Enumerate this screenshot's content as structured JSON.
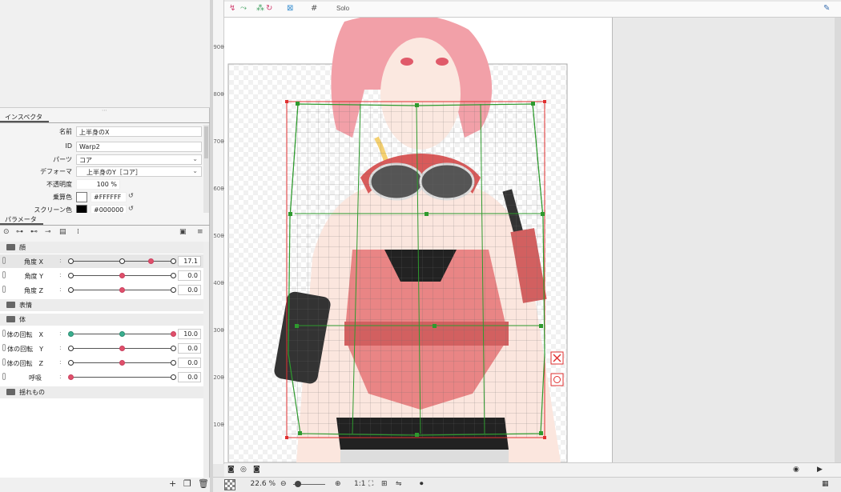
{
  "inspector": {
    "tab": "インスペクタ",
    "rows": [
      {
        "label": "名前",
        "value": "上半身のX"
      },
      {
        "label": "ID",
        "value": "Warp2"
      },
      {
        "label": "パーツ",
        "value": "コア"
      },
      {
        "label": "デフォーマ",
        "value": "上半身のY［コア］"
      },
      {
        "label": "不透明度",
        "value": "100 %"
      },
      {
        "label": "乗算色",
        "value": "#FFFFFF"
      },
      {
        "label": "スクリーン色",
        "value": "#000000"
      }
    ]
  },
  "parameters": {
    "tab": "パラメータ",
    "groups": [
      {
        "name": "顔",
        "params": [
          {
            "name": "角度 X",
            "value": "17.1",
            "pos": 0.78
          },
          {
            "name": "角度 Y",
            "value": "0.0",
            "pos": 0.5
          },
          {
            "name": "角度 Z",
            "value": "0.0",
            "pos": 0.5
          }
        ]
      },
      {
        "name": "表情",
        "params": []
      },
      {
        "name": "体",
        "params": [
          {
            "name": "体の回転　X",
            "value": "10.0",
            "pos": 1.0
          },
          {
            "name": "体の回転　Y",
            "value": "0.0",
            "pos": 0.5
          },
          {
            "name": "体の回転　Z",
            "value": "0.0",
            "pos": 0.5
          },
          {
            "name": "呼吸",
            "value": "0.0",
            "pos": 0.0
          }
        ]
      },
      {
        "name": "揺れもの",
        "params": []
      }
    ]
  },
  "viewer": {
    "solo_label": "Solo",
    "zoom": "22.6 %",
    "ratio": "1:1",
    "ruler_labels": [
      "900",
      "800",
      "700",
      "600",
      "500",
      "400",
      "300",
      "200",
      "100"
    ]
  },
  "colors": {
    "accent": "#e0506a",
    "teal": "#3aaf8f",
    "mesh_green": "#2e9a2e",
    "frame_red": "#e03030"
  }
}
